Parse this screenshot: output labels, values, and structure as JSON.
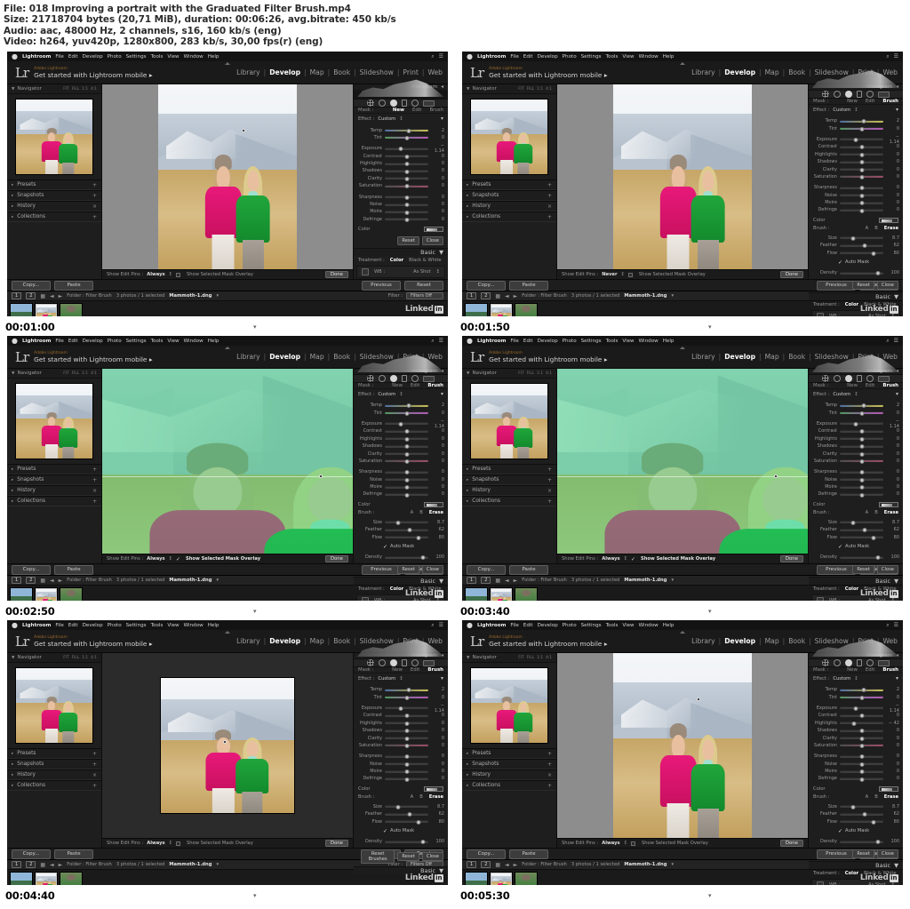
{
  "meta": {
    "line1": "File: 018 Improving a portrait with the Graduated Filter Brush.mp4",
    "line2": "Size: 21718704 bytes (20,71 MiB), duration: 00:06:26, avg.bitrate: 450 kb/s",
    "line3": "Audio: aac, 48000 Hz, 2 channels, s16, 160 kb/s (eng)",
    "line4": "Video: h264, yuv420p, 1280x800, 283 kb/s, 30,00 fps(r) (eng)"
  },
  "app": {
    "apple_glyph": "●",
    "menu": [
      "Lightroom",
      "File",
      "Edit",
      "Develop",
      "Photo",
      "Settings",
      "Tools",
      "View",
      "Window",
      "Help"
    ],
    "menu_right": [
      "search-icon",
      "list-icon"
    ],
    "logo": "Lr",
    "identity_small": "Adobe Lightroom",
    "identity_big": "Get started with Lightroom mobile",
    "identity_caret": "▸",
    "modules": [
      {
        "label": "Library",
        "active": false
      },
      {
        "label": "Develop",
        "active": true
      },
      {
        "label": "Map",
        "active": false
      },
      {
        "label": "Book",
        "active": false
      },
      {
        "label": "Slideshow",
        "active": false
      },
      {
        "label": "Print",
        "active": false
      },
      {
        "label": "Web",
        "active": false
      }
    ],
    "module_sep": "|"
  },
  "left_panel": {
    "navigator": {
      "title": "Navigator",
      "twirl": "▼",
      "zoom_levels": [
        "FIT",
        "FILL",
        "1:1",
        "4:1"
      ]
    },
    "sections": [
      {
        "label": "Presets",
        "plus": "+"
      },
      {
        "label": "Snapshots",
        "plus": "+"
      },
      {
        "label": "History",
        "plus": "×"
      },
      {
        "label": "Collections",
        "plus": "+"
      }
    ],
    "section_arrow": "▸",
    "buttons": {
      "copy": "Copy...",
      "paste": "Paste"
    }
  },
  "right_panel": {
    "histogram_title": "Histogram",
    "histogram_caret": "◂",
    "tools": [
      "crop-tool-icon",
      "spot-removal-icon",
      "red-eye-icon",
      "graduated-filter-icon",
      "radial-filter-icon",
      "adjustment-brush-icon"
    ],
    "mask": {
      "label": "Mask :",
      "options": [
        {
          "label": "New",
          "active": true
        },
        {
          "label": "Edit",
          "active": false
        },
        {
          "label": "Brush",
          "active": false
        }
      ]
    },
    "mask_brush": {
      "label": "Mask :",
      "options": [
        {
          "label": "New",
          "active": false
        },
        {
          "label": "Edit",
          "active": false
        },
        {
          "label": "Brush",
          "active": true
        }
      ]
    },
    "effect": {
      "label": "Effect :",
      "value": "Custom",
      "caret": "↕"
    },
    "sliders_top": [
      {
        "name": "Temp",
        "value": "2",
        "pos": 56,
        "kind": "temp"
      },
      {
        "name": "Tint",
        "value": "0",
        "pos": 50,
        "kind": "tint"
      }
    ],
    "sliders_mid": [
      {
        "name": "Exposure",
        "value": "− 1.14",
        "pos": 36,
        "kind": ""
      },
      {
        "name": "Contrast",
        "value": "0",
        "pos": 50,
        "kind": ""
      },
      {
        "name": "Highlights",
        "value": "0",
        "pos": 50,
        "kind": ""
      },
      {
        "name": "Shadows",
        "value": "0",
        "pos": 50,
        "kind": ""
      },
      {
        "name": "Clarity",
        "value": "0",
        "pos": 50,
        "kind": ""
      },
      {
        "name": "Saturation",
        "value": "0",
        "pos": 50,
        "kind": "sat"
      }
    ],
    "sliders_mid_alt": [
      {
        "name": "Exposure",
        "value": "− 1.14",
        "pos": 36,
        "kind": ""
      },
      {
        "name": "Contrast",
        "value": "0",
        "pos": 50,
        "kind": ""
      },
      {
        "name": "Highlights",
        "value": "− 42",
        "pos": 32,
        "kind": ""
      },
      {
        "name": "Shadows",
        "value": "0",
        "pos": 50,
        "kind": ""
      },
      {
        "name": "Clarity",
        "value": "0",
        "pos": 50,
        "kind": ""
      },
      {
        "name": "Saturation",
        "value": "0",
        "pos": 50,
        "kind": "sat"
      }
    ],
    "sliders_bot": [
      {
        "name": "Sharpness",
        "value": "0",
        "pos": 50,
        "kind": ""
      },
      {
        "name": "Noise",
        "value": "0",
        "pos": 50,
        "kind": ""
      },
      {
        "name": "Moire",
        "value": "0",
        "pos": 50,
        "kind": ""
      },
      {
        "name": "Defringe",
        "value": "0",
        "pos": 50,
        "kind": ""
      }
    ],
    "color_row": {
      "label": "Color",
      "swatch": "color-swatch"
    },
    "brush": {
      "label": "Brush :",
      "options": [
        {
          "label": "A",
          "active": false
        },
        {
          "label": "B",
          "active": false
        },
        {
          "label": "Erase",
          "active": true
        }
      ],
      "sliders": [
        {
          "name": "Size",
          "value": "8.7",
          "pos": 30
        },
        {
          "name": "Feather",
          "value": "62",
          "pos": 58
        },
        {
          "name": "Flow",
          "value": "80",
          "pos": 78
        }
      ],
      "auto_mask": "Auto Mask",
      "density": {
        "name": "Density",
        "value": "100",
        "pos": 88
      }
    },
    "reset_buttons": {
      "reset_brushes": "Reset Brushes",
      "reset": "Reset",
      "close": "Close"
    },
    "small_buttons": {
      "reset": "Reset",
      "close": "Close"
    },
    "basic_title": "Basic",
    "basic_caret": "▼",
    "treatment": {
      "label": "Treatment :",
      "options": [
        {
          "label": "Color",
          "active": true
        },
        {
          "label": "Black & White",
          "active": false
        }
      ]
    },
    "wb": {
      "label": "WB :",
      "value": "As Shot",
      "caret": "↕",
      "eyedropper": "eyedropper-icon"
    },
    "buttons": {
      "previous": "Previous",
      "reset": "Reset"
    }
  },
  "toolbar": {
    "show_edit_pins_label": "Show Edit Pins :",
    "show_edit_pins_always": "Always",
    "show_edit_pins_never": "Never",
    "stepper": "↕",
    "mask_overlay": "Show Selected Mask Overlay",
    "done": "Done",
    "check": "✓"
  },
  "filmstrip": {
    "source_label": "Folder : Filter Brush",
    "count": "3 photos / 1 selected",
    "filename": "Mammoth-1.dng",
    "filename_caret": "▾",
    "filter_label": "Filter :",
    "filter_value": "Filters Off",
    "badges": [
      "1",
      "2"
    ],
    "icons": [
      "grid-view-icon",
      "prev-photo-icon",
      "next-photo-icon"
    ],
    "thumbs": [
      "coastline-thumb",
      "two-girls-field-thumb",
      "green-jacket-thumb"
    ]
  },
  "brand": {
    "text": "Linked",
    "mark": "in"
  },
  "frames": [
    {
      "timecode": "00:01:00",
      "variant": "normal",
      "pins": "always",
      "overlay": false,
      "mask_mode": "new"
    },
    {
      "timecode": "00:01:50",
      "variant": "normal",
      "pins": "never",
      "overlay": false,
      "mask_mode": "brush"
    },
    {
      "timecode": "00:02:50",
      "variant": "overlay",
      "pins": "always",
      "overlay": true,
      "mask_mode": "brush"
    },
    {
      "timecode": "00:03:40",
      "variant": "overlay",
      "pins": "always",
      "overlay": true,
      "mask_mode": "brush"
    },
    {
      "timecode": "00:04:40",
      "variant": "small",
      "pins": "always",
      "overlay": false,
      "mask_mode": "brush"
    },
    {
      "timecode": "00:05:30",
      "variant": "normal",
      "pins": "always",
      "overlay": false,
      "mask_mode": "brush"
    }
  ]
}
